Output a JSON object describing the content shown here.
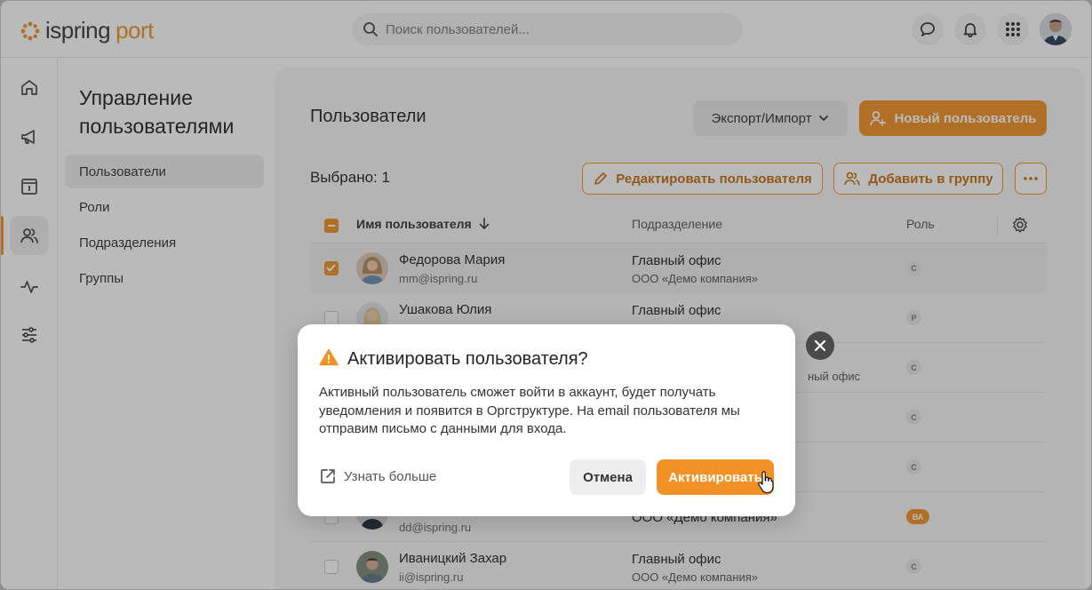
{
  "brand": {
    "word1": "ispring",
    "word2": "port",
    "accent": "#f29226"
  },
  "search": {
    "placeholder": "Поиск пользователей..."
  },
  "topbar_icons": [
    "chat-icon",
    "bell-icon",
    "apps-grid-icon"
  ],
  "rail": [
    "home-icon",
    "megaphone-icon",
    "info-card-icon",
    "users-icon",
    "activity-icon",
    "sliders-icon"
  ],
  "side": {
    "title": "Управление пользователями",
    "items": [
      "Пользователи",
      "Роли",
      "Подразделения",
      "Группы"
    ]
  },
  "main": {
    "title": "Пользователи",
    "export_label": "Экспорт/Импорт",
    "new_user_label": "Новый пользователь",
    "selected_label": "Выбрано: 1",
    "edit_label": "Редактировать пользователя",
    "add_group_label": "Добавить в группу",
    "columns": {
      "name": "Имя пользователя",
      "dept": "Подразделение",
      "role": "Роль"
    }
  },
  "rows": [
    {
      "name": "Федорова Мария",
      "email": "mm@ispring.ru",
      "dept": "Главный офис",
      "company": "ООО «Демо компания»",
      "role": "С",
      "checked": true
    },
    {
      "name": "Ушакова Юлия",
      "email": "",
      "dept": "Главный офис",
      "company": "",
      "role": "Р",
      "checked": false
    },
    {
      "name": "",
      "email": "",
      "dept": "ный офис",
      "company": "",
      "role": "С",
      "checked": false
    },
    {
      "name": "",
      "email": "",
      "dept": "",
      "company": "",
      "role": "С",
      "checked": false
    },
    {
      "name": "",
      "email": "",
      "dept": "",
      "company": "",
      "role": "С",
      "checked": false
    },
    {
      "name": "",
      "email": "dd@ispring.ru",
      "dept": "",
      "company": "ООО «Демо компания»",
      "role": "ВА",
      "checked": false
    },
    {
      "name": "Иваницкий Захар",
      "email": "ii@ispring.ru",
      "dept": "Главный офис",
      "company": "ООО «Демо компания»",
      "role": "С",
      "checked": false
    }
  ],
  "modal": {
    "title": "Активировать пользователя?",
    "body": "Активный пользователь сможет войти в аккаунт, будет получать уведомления и появится в Оргструктуре. На email пользователя мы отправим письмо с данными для входа.",
    "learn_more": "Узнать больше",
    "cancel": "Отмена",
    "activate": "Активировать"
  }
}
